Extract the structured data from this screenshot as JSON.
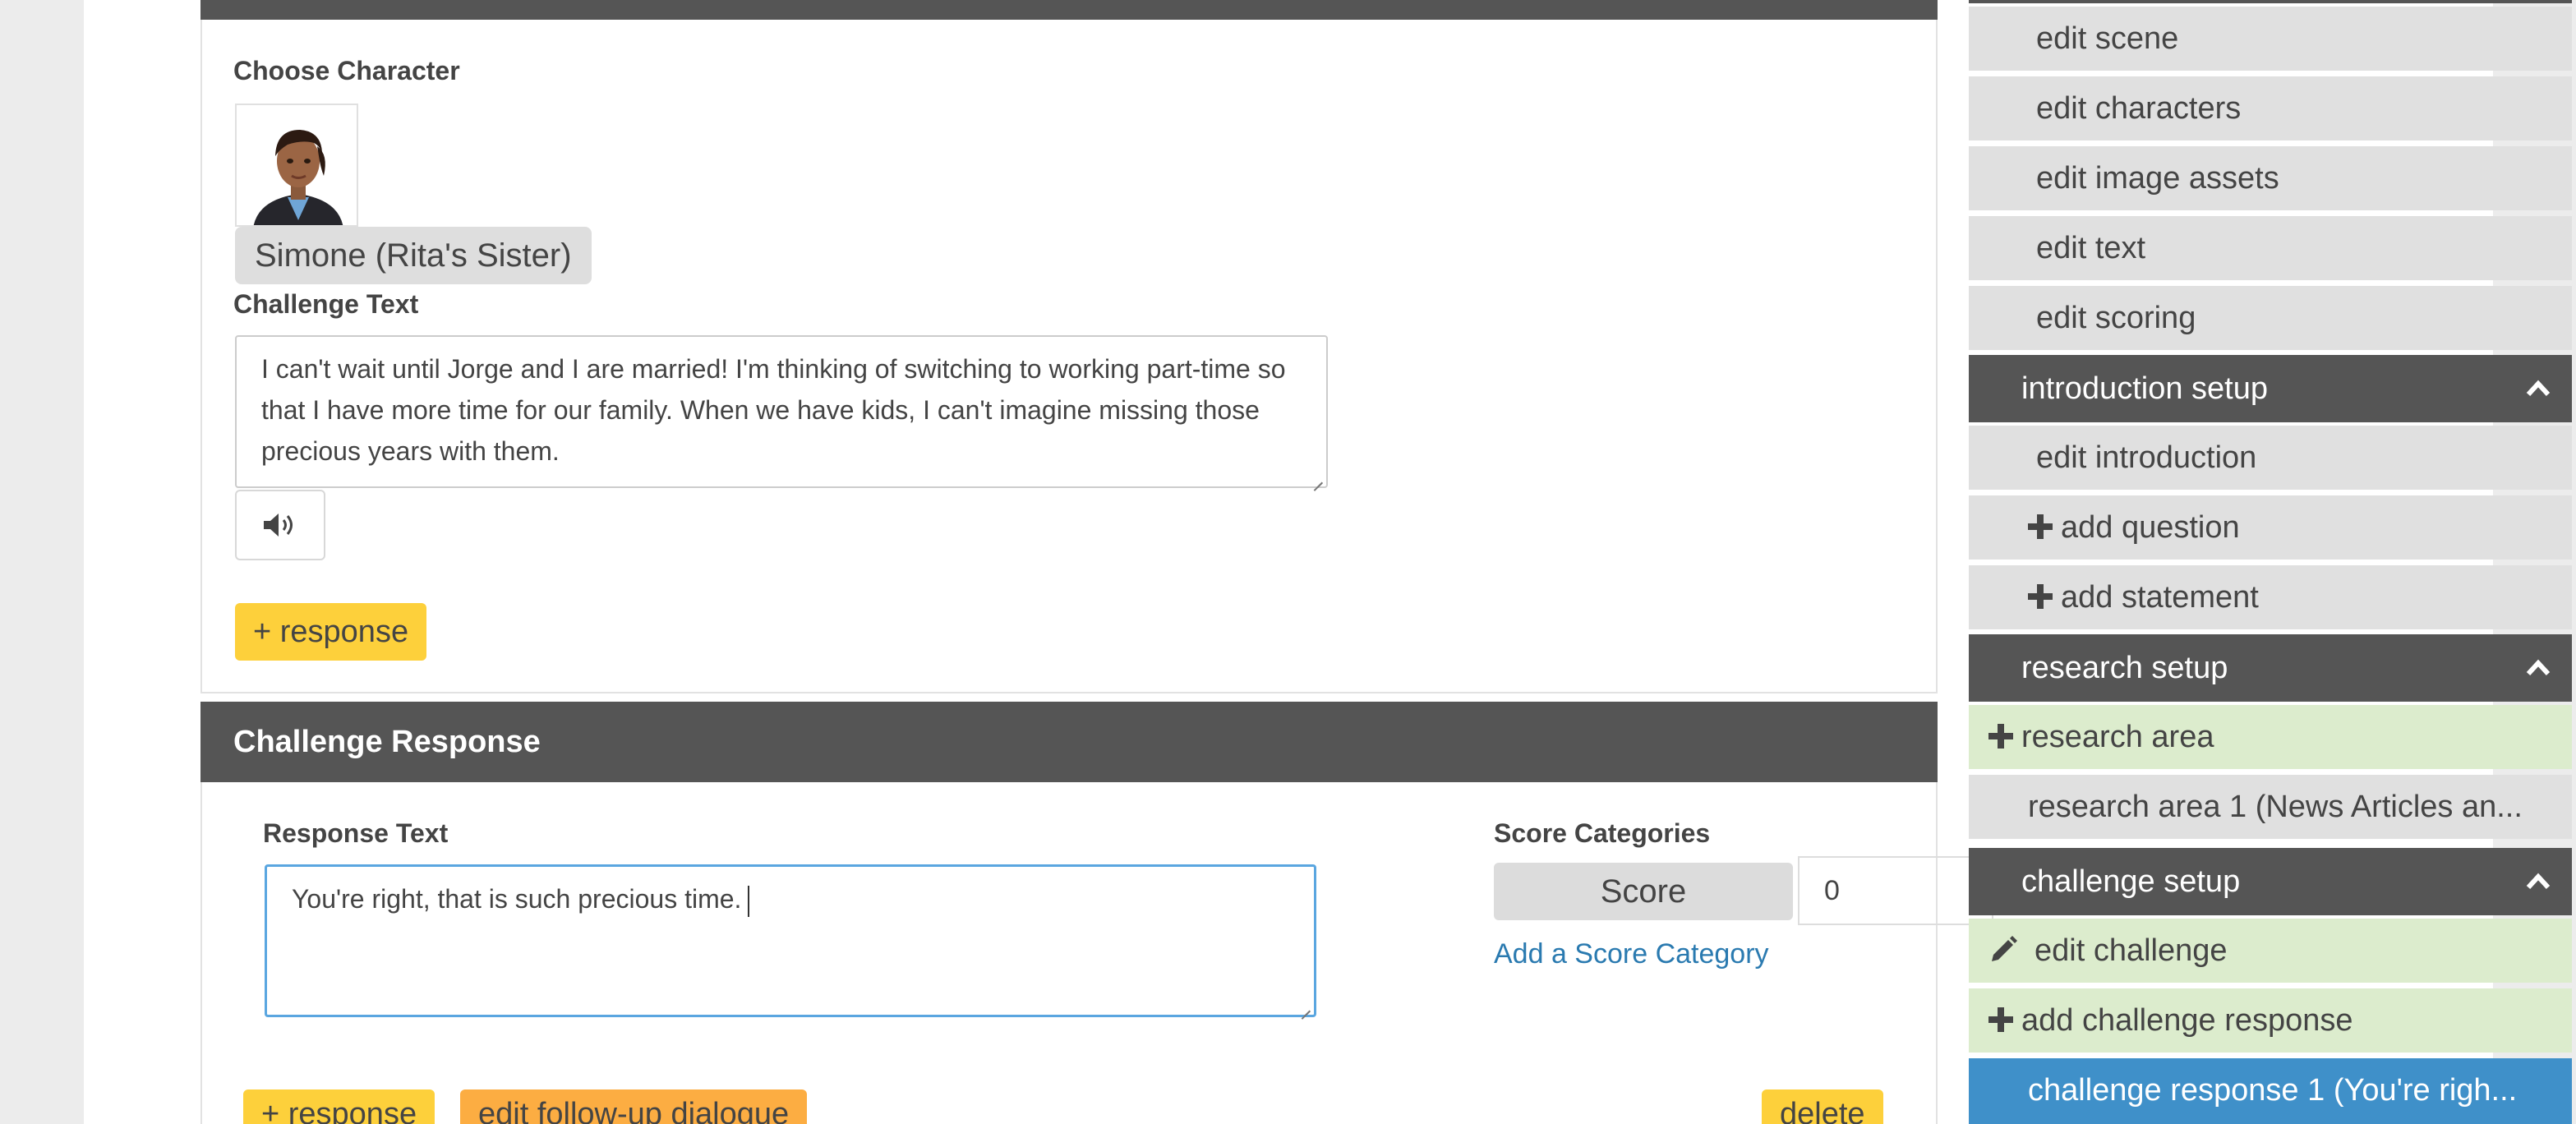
{
  "challenge_panel": {
    "choose_character_label": "Choose Character",
    "character_name": "Simone (Rita's Sister)",
    "challenge_text_label": "Challenge Text",
    "challenge_text": "I can't wait until Jorge and I are married! I'm thinking of switching to working part-time so that I have more time for our family. When we have kids, I can't imagine missing those precious years with them.",
    "audio_icon": "speaker-icon",
    "add_response_label": "+ response"
  },
  "response_panel": {
    "title": "Challenge Response",
    "response_text_label": "Response Text",
    "response_text": "You're right, that is such precious time.",
    "score_categories_label": "Score Categories",
    "score_label": "Score",
    "score_value": "0",
    "add_score_category_link": "Add a Score Category",
    "add_response_label": "+ response",
    "edit_followup_label": "edit follow-up dialogue",
    "delete_label": "delete"
  },
  "sidebar": {
    "scene_items": [
      "edit scene",
      "edit characters",
      "edit image assets",
      "edit text",
      "edit scoring"
    ],
    "introduction_header": "introduction setup",
    "introduction_items": [
      "edit introduction",
      "add question",
      "add statement"
    ],
    "research_header": "research setup",
    "research_add": "research area",
    "research_area_1": "research area 1 (News Articles an...",
    "challenge_header": "challenge setup",
    "edit_challenge": "edit challenge",
    "add_challenge_response": "add challenge response",
    "challenge_response_1": "challenge response 1 (You're righ..."
  },
  "colors": {
    "dark_header": "#555555",
    "sidebar_item": "#e0e0e0",
    "sidebar_green": "#dceccd",
    "sidebar_active": "#3f90c9",
    "button_yellow": "#fdd03b",
    "button_orange": "#fcad42",
    "link_blue": "#2a7ab0",
    "focus_border": "#5aa6e0"
  }
}
